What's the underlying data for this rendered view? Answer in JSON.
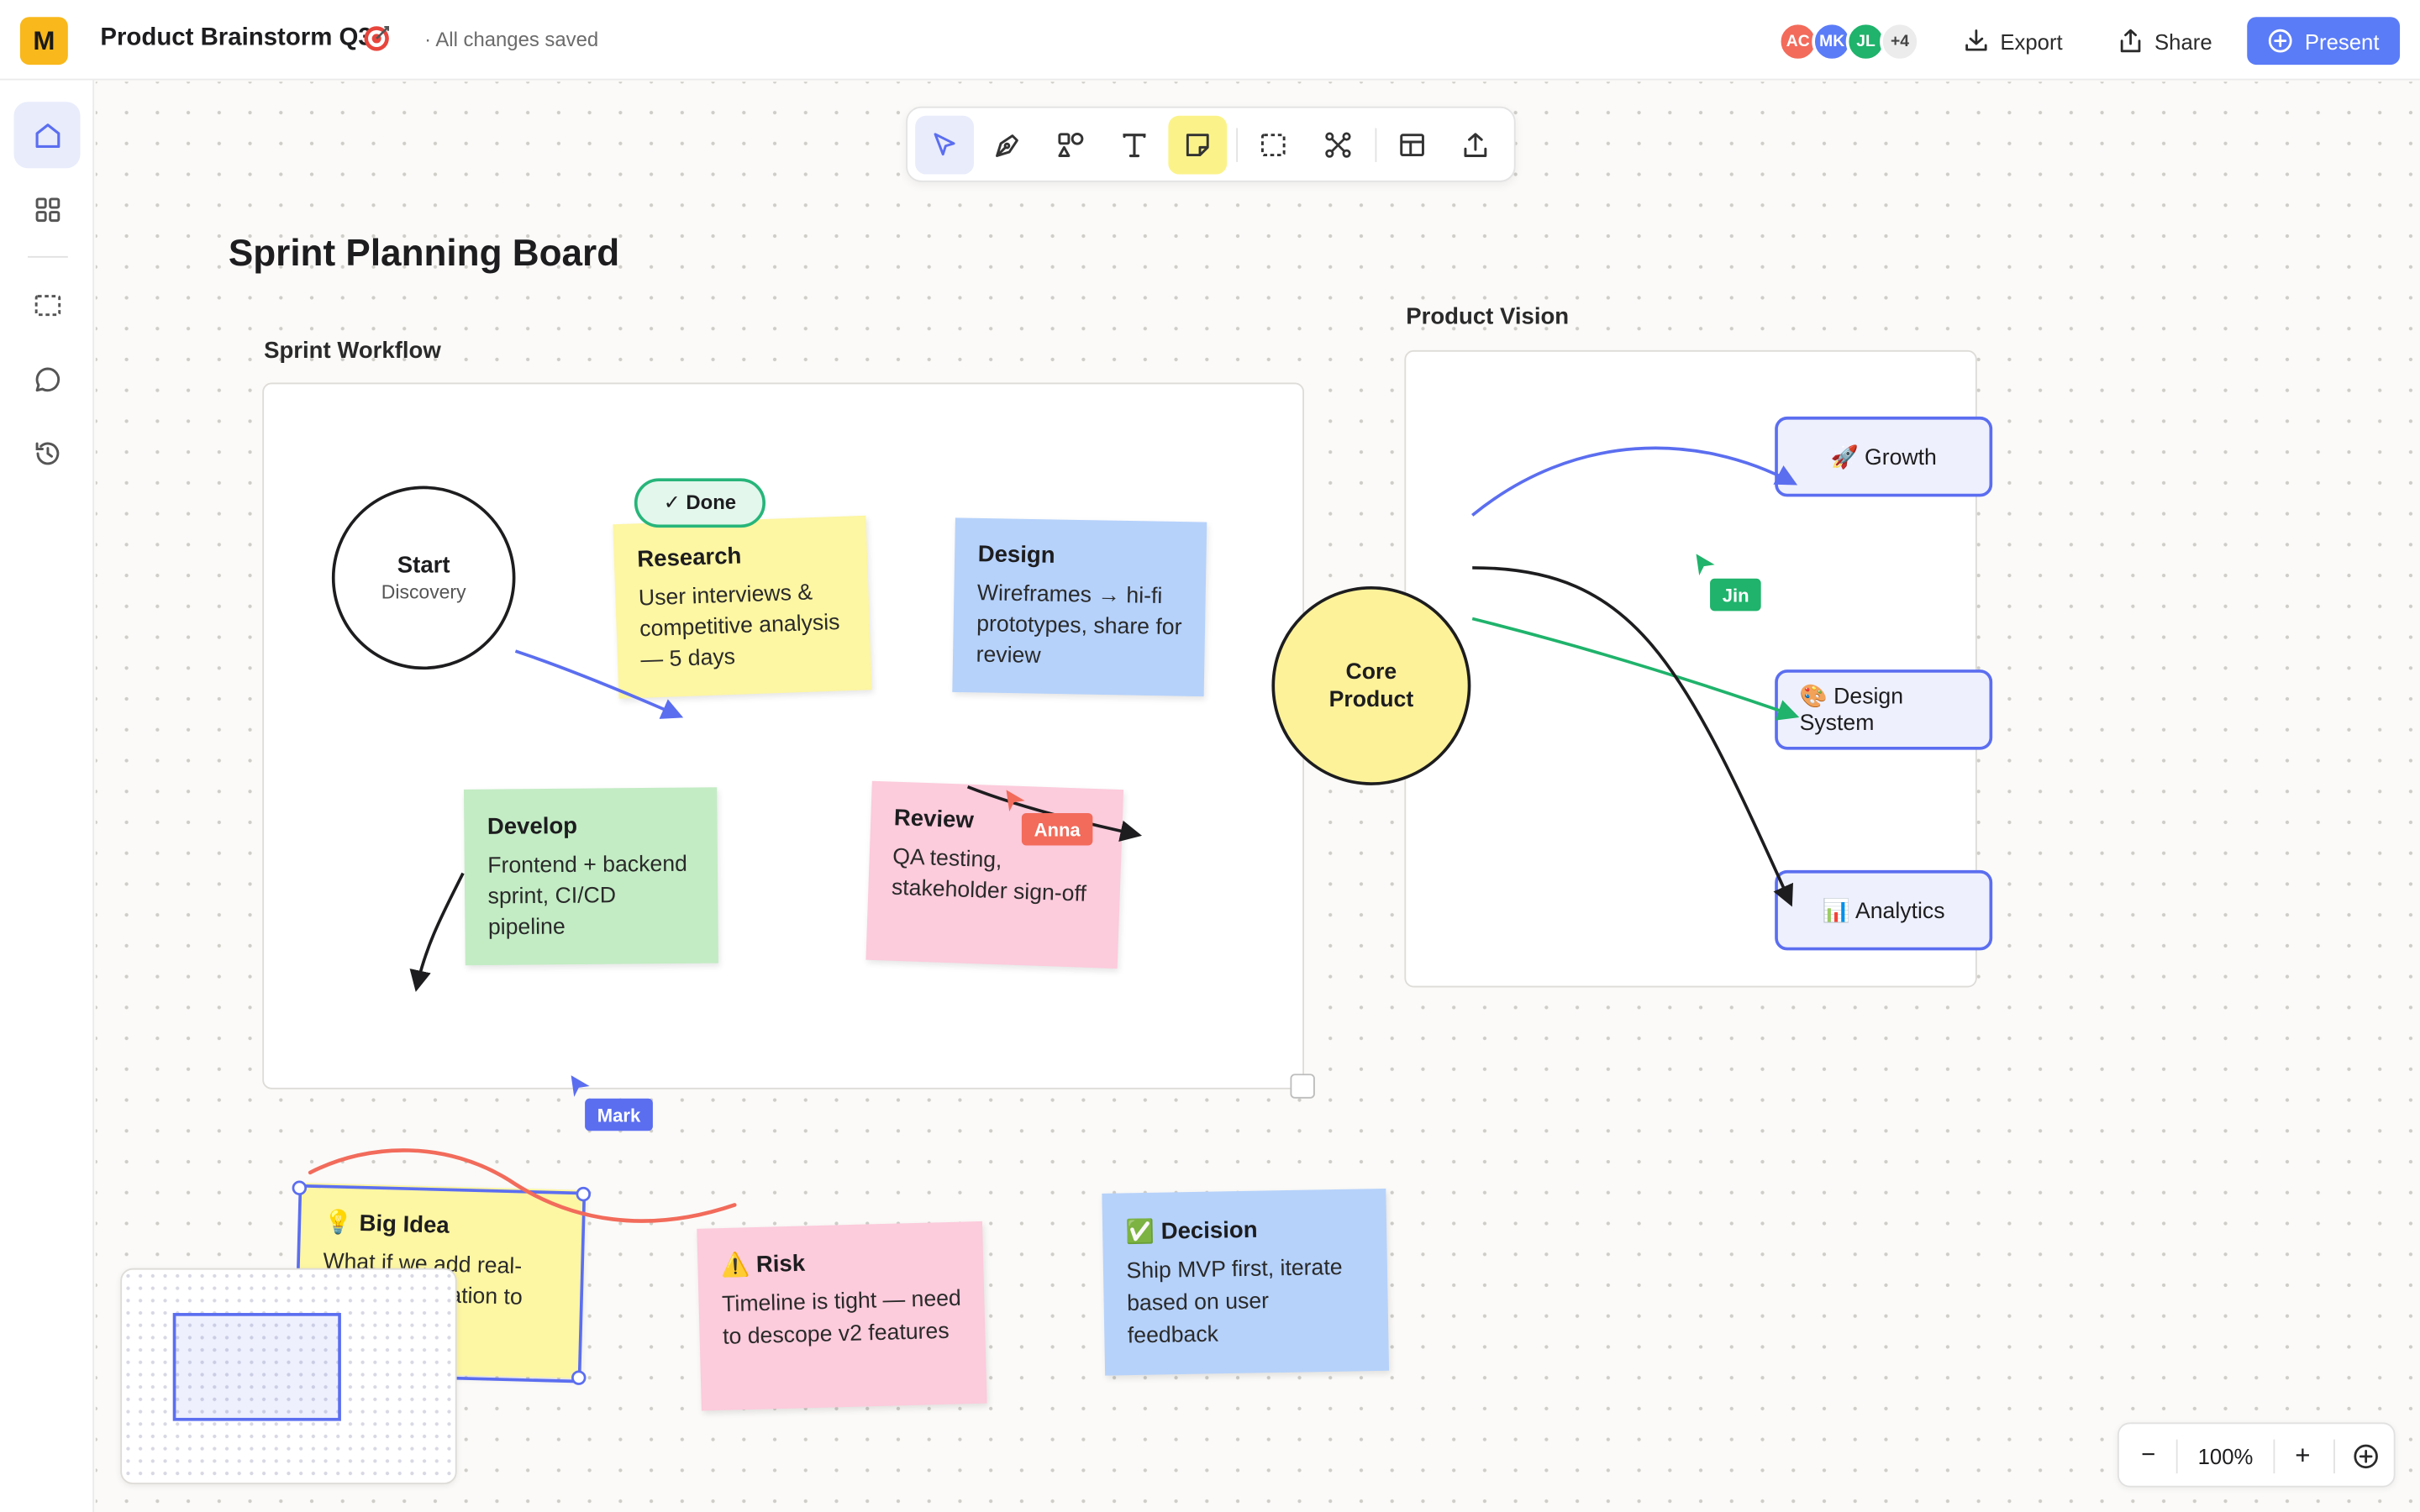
{
  "app": {
    "logo": "M",
    "doc_title": "Product Brainstorm Q3",
    "save_status": "· All changes saved"
  },
  "collaborators": [
    {
      "initials": "AC",
      "color": "#f26b5b"
    },
    {
      "initials": "MK",
      "color": "#5b7cf7"
    },
    {
      "initials": "JL",
      "color": "#1fb36b"
    }
  ],
  "collaborators_more": "+4",
  "header_actions": {
    "export": "Export",
    "share": "Share",
    "present": "Present"
  },
  "sidebar": {
    "items": [
      "home-icon",
      "grid-icon",
      "frame-icon",
      "comment-icon",
      "history-icon"
    ]
  },
  "toolbar": {
    "tools": [
      "select",
      "pen",
      "shapes",
      "text",
      "sticky-note",
      "frame",
      "connector",
      "template",
      "upload"
    ],
    "active_tool": "select",
    "highlighted_tool": "sticky-note"
  },
  "board": {
    "title": "Sprint Planning Board"
  },
  "workflow": {
    "label": "Sprint Workflow",
    "start": {
      "title": "Start",
      "subtitle": "Discovery"
    },
    "done_badge": "✓ Done",
    "notes": {
      "research": {
        "title": "Research",
        "body": "User interviews & competitive analysis — 5 days"
      },
      "design": {
        "title": "Design",
        "body": "Wireframes → hi-fi prototypes, share for review"
      },
      "develop": {
        "title": "Develop",
        "body": "Frontend + backend sprint, CI/CD pipeline"
      },
      "review": {
        "title": "Review",
        "body": "QA testing, stakeholder sign-off"
      }
    }
  },
  "vision": {
    "label": "Product Vision",
    "core": "Core Product",
    "nodes": {
      "growth": "🚀 Growth",
      "design_system": "🎨 Design System",
      "analytics": "📊 Analytics"
    }
  },
  "loose_notes": {
    "big_idea": {
      "title": "💡 Big Idea",
      "body": "What if we add real-time collaboration to"
    },
    "risk": {
      "title": "⚠️ Risk",
      "body": "Timeline is tight — need to descope v2 features"
    },
    "decision": {
      "title": "✅ Decision",
      "body": "Ship MVP first, iterate based on user feedback"
    }
  },
  "cursors": {
    "anna": {
      "name": "Anna",
      "color": "#f26b5b"
    },
    "jin": {
      "name": "Jin",
      "color": "#1fb36b"
    },
    "mark": {
      "name": "Mark",
      "color": "#5b6ef0"
    }
  },
  "zoom": {
    "level": "100%",
    "minus": "−",
    "plus": "+"
  },
  "colors": {
    "accent": "#5b7cf7",
    "sticky_yellow": "#fdf6a3",
    "sticky_blue": "#b6d2fb",
    "sticky_green": "#c3ecc4",
    "sticky_pink": "#fccbdc"
  }
}
